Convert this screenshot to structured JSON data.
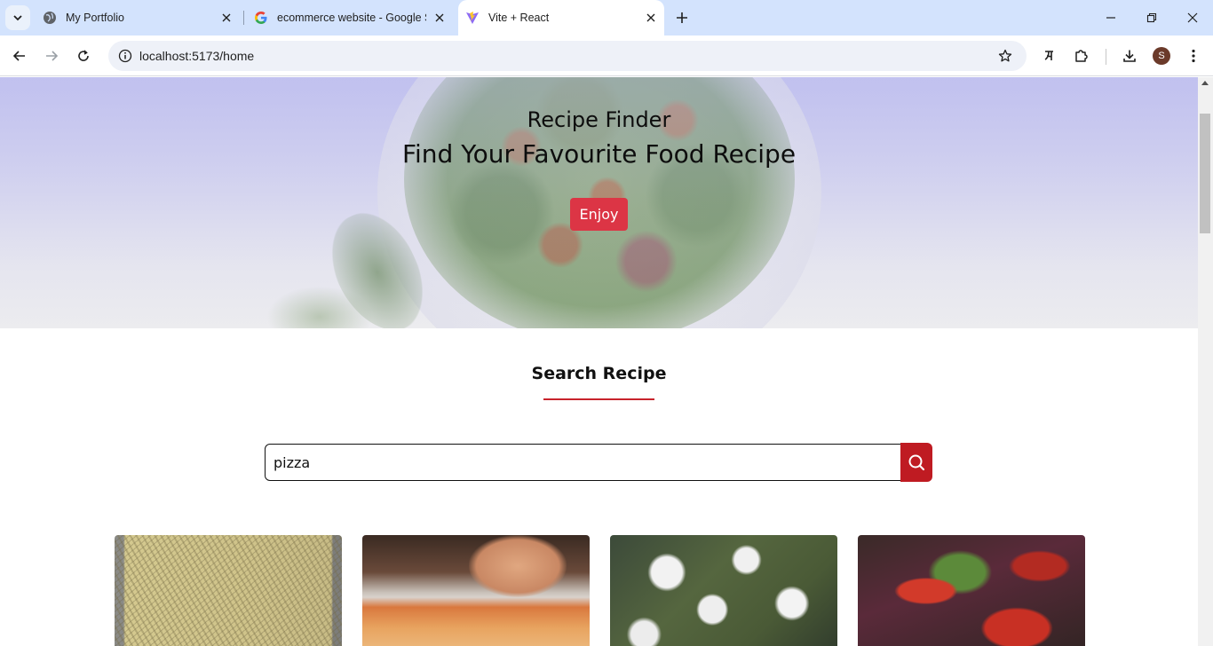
{
  "browser": {
    "tabs": [
      {
        "title": "My Portfolio",
        "favicon": "globe-icon"
      },
      {
        "title": "ecommerce website - Google S",
        "favicon": "google-icon"
      },
      {
        "title": "Vite + React",
        "favicon": "vite-icon",
        "active": true
      }
    ],
    "address": "localhost:5173/home",
    "profile_initial": "S"
  },
  "hero": {
    "subtitle": "Recipe Finder",
    "headline": "Find Your Favourite Food Recipe",
    "cta_label": "Enjoy"
  },
  "search": {
    "section_title": "Search Recipe",
    "query": "pizza"
  },
  "results": [
    {
      "image": "onion flatbread"
    },
    {
      "image": "cheese pizza being topped"
    },
    {
      "image": "herb flatbread with cheese"
    },
    {
      "image": "tomato and greens pizza"
    }
  ],
  "colors": {
    "accent_red": "#dc3545",
    "search_button": "#bf1b22",
    "underline": "#c8232c",
    "tabstrip": "#d3e3fd"
  }
}
